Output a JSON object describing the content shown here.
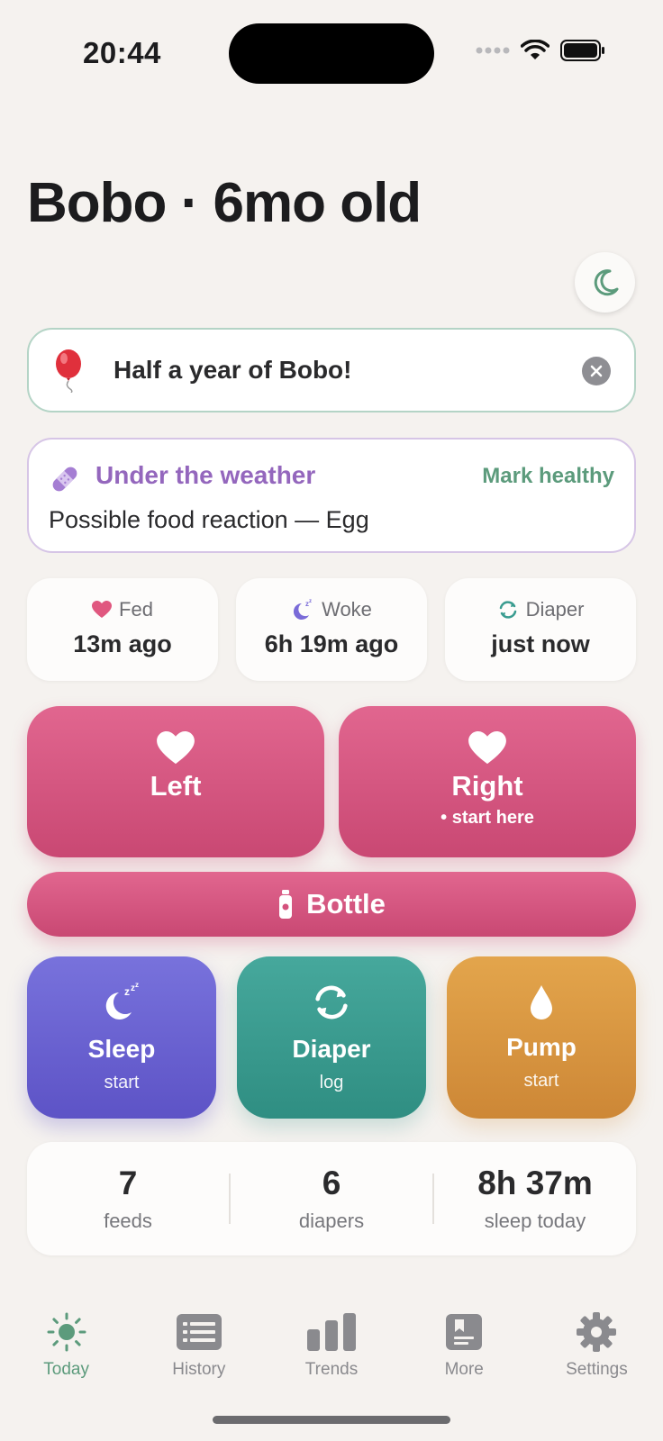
{
  "status_bar": {
    "time": "20:44"
  },
  "header": {
    "title": "Bobo · 6mo old"
  },
  "night_mode": {
    "icon": "moon-icon"
  },
  "milestone": {
    "icon": "balloon-icon",
    "text": "Half a year of Bobo!"
  },
  "sick": {
    "icon": "bandage-icon",
    "title": "Under the weather",
    "action": "Mark healthy",
    "detail": "Possible food reaction — Egg"
  },
  "stats": [
    {
      "icon": "heart-icon",
      "label": "Fed",
      "value": "13m ago"
    },
    {
      "icon": "sleep-moon-icon",
      "label": "Woke",
      "value": "6h 19m ago"
    },
    {
      "icon": "refresh-icon",
      "label": "Diaper",
      "value": "just now"
    }
  ],
  "feeding": {
    "left": {
      "label": "Left"
    },
    "right": {
      "label": "Right",
      "hint": "• start here"
    },
    "bottle": {
      "label": "Bottle"
    }
  },
  "actions": {
    "sleep": {
      "label": "Sleep",
      "sub": "start"
    },
    "diaper": {
      "label": "Diaper",
      "sub": "log"
    },
    "pump": {
      "label": "Pump",
      "sub": "start"
    }
  },
  "summary": [
    {
      "value": "7",
      "label": "feeds"
    },
    {
      "value": "6",
      "label": "diapers"
    },
    {
      "value": "8h 37m",
      "label": "sleep today"
    }
  ],
  "tabs": [
    {
      "label": "Today",
      "icon": "sun-icon",
      "active": true
    },
    {
      "label": "History",
      "icon": "list-icon",
      "active": false
    },
    {
      "label": "Trends",
      "icon": "bar-chart-icon",
      "active": false
    },
    {
      "label": "More",
      "icon": "book-icon",
      "active": false
    },
    {
      "label": "Settings",
      "icon": "gear-icon",
      "active": false
    }
  ],
  "colors": {
    "background": "#f5f2ef",
    "accent_green": "#5c9b7c",
    "feed_pink": "#d8557f",
    "sleep_purple": "#6b63d2",
    "diaper_teal": "#3a9c90",
    "pump_orange": "#d99442",
    "sick_purple": "#9467bd"
  }
}
